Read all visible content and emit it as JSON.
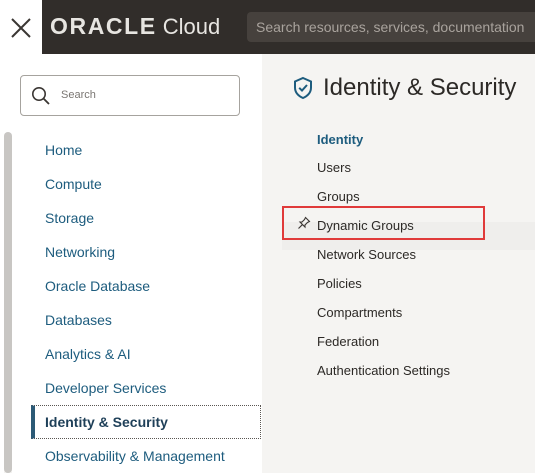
{
  "topbar": {
    "brand_oracle": "ORACLE",
    "brand_cloud": "Cloud",
    "search_placeholder": "Search resources, services, documentation",
    "close_icon": "close-icon"
  },
  "left": {
    "search_placeholder": "Search",
    "nav": [
      {
        "label": "Home",
        "active": false
      },
      {
        "label": "Compute",
        "active": false
      },
      {
        "label": "Storage",
        "active": false
      },
      {
        "label": "Networking",
        "active": false
      },
      {
        "label": "Oracle Database",
        "active": false
      },
      {
        "label": "Databases",
        "active": false
      },
      {
        "label": "Analytics & AI",
        "active": false
      },
      {
        "label": "Developer Services",
        "active": false
      },
      {
        "label": "Identity & Security",
        "active": true
      },
      {
        "label": "Observability & Management",
        "active": false
      }
    ]
  },
  "right": {
    "title": "Identity & Security",
    "section_heading": "Identity",
    "items": [
      {
        "label": "Users",
        "pinned": false,
        "highlighted": false
      },
      {
        "label": "Groups",
        "pinned": false,
        "highlighted": false
      },
      {
        "label": "Dynamic Groups",
        "pinned": true,
        "highlighted": true
      },
      {
        "label": "Network Sources",
        "pinned": false,
        "highlighted": false
      },
      {
        "label": "Policies",
        "pinned": false,
        "highlighted": false
      },
      {
        "label": "Compartments",
        "pinned": false,
        "highlighted": false
      },
      {
        "label": "Federation",
        "pinned": false,
        "highlighted": false
      },
      {
        "label": "Authentication Settings",
        "pinned": false,
        "highlighted": false
      }
    ]
  },
  "colors": {
    "topbar": "#312d2a",
    "link": "#1d5c7e",
    "highlight": "#e03a3a"
  }
}
